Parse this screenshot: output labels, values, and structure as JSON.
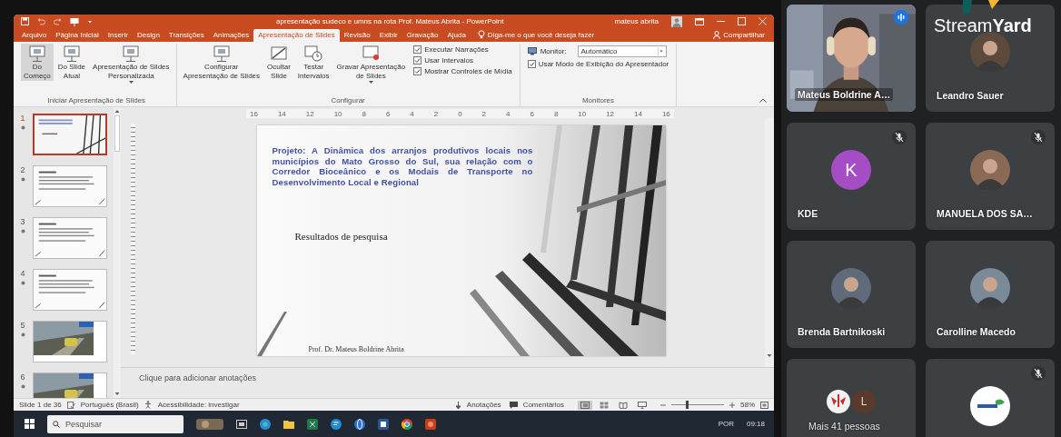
{
  "window": {
    "title": "apresentação sudeco e umns na rota Prof. Mateus Abrita  -  PowerPoint",
    "user": "mateus abrita"
  },
  "tabs": [
    {
      "label": "Arquivo",
      "selected": false
    },
    {
      "label": "Página Inicial",
      "selected": false
    },
    {
      "label": "Inserir",
      "selected": false
    },
    {
      "label": "Design",
      "selected": false
    },
    {
      "label": "Transições",
      "selected": false
    },
    {
      "label": "Animações",
      "selected": false
    },
    {
      "label": "Apresentação de Slides",
      "selected": true
    },
    {
      "label": "Revisão",
      "selected": false
    },
    {
      "label": "Exibir",
      "selected": false
    },
    {
      "label": "Gravação",
      "selected": false
    },
    {
      "label": "Ajuda",
      "selected": false
    }
  ],
  "tell_me": {
    "placeholder": "Diga-me o que você deseja fazer"
  },
  "share": "Compartilhar",
  "ribbon": {
    "groups": [
      {
        "label": "Iniciar Apresentação de Slides",
        "buttons": [
          {
            "label": "Do\nComeço",
            "highlighted": true,
            "menu": false
          },
          {
            "label": "Do Slide\nAtual",
            "highlighted": false,
            "menu": false
          },
          {
            "label": "Apresentação de Slides\nPersonalizada",
            "highlighted": false,
            "menu": true
          }
        ]
      },
      {
        "label": "Configurar",
        "buttons": [
          {
            "label": "Configurar\nApresentação de Slides",
            "highlighted": false,
            "menu": false
          },
          {
            "label": "Ocultar\nSlide",
            "highlighted": false,
            "menu": false
          },
          {
            "label": "Testar\nIntervalos",
            "highlighted": false,
            "menu": false
          },
          {
            "label": "Gravar Apresentação\nde Slides",
            "highlighted": false,
            "menu": true
          }
        ],
        "checks": [
          {
            "label": "Executar Narrações",
            "checked": true
          },
          {
            "label": "Usar Intervalos",
            "checked": true
          },
          {
            "label": "Mostrar Controles de Mídia",
            "checked": true
          }
        ]
      },
      {
        "label": "Monitores",
        "monitor": {
          "label": "Monitor:",
          "value": "Automático"
        },
        "checks": [
          {
            "label": "Usar Modo de Exibição do Apresentador",
            "checked": true
          }
        ]
      }
    ]
  },
  "ruler": [
    "16",
    "14",
    "12",
    "10",
    "8",
    "6",
    "4",
    "2",
    "0",
    "2",
    "4",
    "6",
    "8",
    "10",
    "12",
    "14",
    "16"
  ],
  "thumbnails": [
    {
      "number": "1",
      "kind": "title",
      "selected": true
    },
    {
      "number": "2",
      "kind": "text",
      "selected": false
    },
    {
      "number": "3",
      "kind": "text",
      "selected": false
    },
    {
      "number": "4",
      "kind": "text",
      "selected": false
    },
    {
      "number": "5",
      "selected": false
    },
    {
      "number": "6",
      "selected": false
    }
  ],
  "slide": {
    "title": "Projeto: A Dinâmica dos arranjos produtivos locais nos municípios do Mato Grosso do Sul, sua relação com o Corredor Bioceânico e os Modais de Transporte no Desenvolvimento Local e Regional",
    "subtitle": "Resultados de pesquisa",
    "footer": "Prof. Dr. Mateus Boldrine Abrita"
  },
  "notes": {
    "placeholder": "Clique para adicionar anotações"
  },
  "status_bar": {
    "slide": "Slide 1 de 36",
    "language": "Português (Brasil)",
    "accessibility": "Acessibilidade: investigar",
    "notes": "Anotações",
    "comments": "Comentários",
    "views": [
      {
        "kind": "normal",
        "selected": true
      },
      {
        "kind": "sorter",
        "selected": false
      },
      {
        "kind": "reading",
        "selected": false
      },
      {
        "kind": "slideshow",
        "selected": false
      }
    ],
    "zoom": {
      "level": 0.3,
      "reading": "58%"
    }
  },
  "taskbar": {
    "search": {
      "placeholder": "Pesquisar"
    },
    "language": "POR",
    "time": "09:18"
  },
  "call": {
    "logo": "Stream**Yard**",
    "participants": [
      {
        "kind": "video",
        "name": "Mateus Boldrine A…",
        "speaking": true,
        "muted": false
      },
      {
        "name": "Leandro Sauer",
        "speaking": false,
        "muted": false
      },
      {
        "kind": "initial",
        "initial": "K",
        "color": "#a64dc6",
        "name": "KDE",
        "speaking": false,
        "muted": true
      },
      {
        "name": "MANUELA DOS SA…",
        "speaking": false,
        "muted": true
      },
      {
        "name": "Brenda Bartnikoski",
        "speaking": false,
        "muted": false
      },
      {
        "name": "Carolline Macedo",
        "speaking": false,
        "muted": false
      },
      {
        "kind": "more",
        "initial": "L",
        "name": "Mais 41 pessoas",
        "speaking": false,
        "muted": false
      },
      {
        "kind": "logo",
        "speaking": false,
        "muted": true
      }
    ]
  }
}
